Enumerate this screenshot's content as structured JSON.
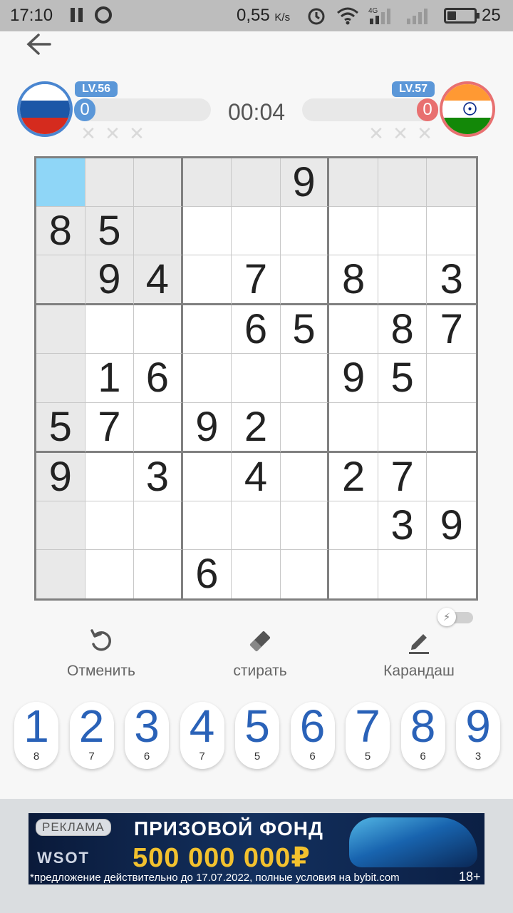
{
  "status_bar": {
    "time": "17:10",
    "speed_value": "0,55",
    "speed_unit": "K/s",
    "network": "4G",
    "battery": "25"
  },
  "players": {
    "left": {
      "country": "Russia",
      "level": "LV.56",
      "score": "0",
      "flag_colors": [
        "#ffffff",
        "#1c57a7",
        "#d52b1e"
      ],
      "mistakes": [
        "✕",
        "✕",
        "✕"
      ]
    },
    "right": {
      "country": "India",
      "level": "LV.57",
      "score": "0",
      "flag_colors": [
        "#ff9933",
        "#ffffff",
        "#138808"
      ],
      "mistakes": [
        "✕",
        "✕",
        "✕"
      ]
    }
  },
  "timer": "00:04",
  "board": {
    "selected_cell": [
      0,
      0
    ],
    "highlighted_cells": [
      [
        0,
        1
      ],
      [
        0,
        2
      ],
      [
        0,
        3
      ],
      [
        0,
        4
      ],
      [
        0,
        5
      ],
      [
        0,
        6
      ],
      [
        0,
        7
      ],
      [
        0,
        8
      ],
      [
        1,
        0
      ],
      [
        1,
        1
      ],
      [
        1,
        2
      ],
      [
        2,
        0
      ],
      [
        2,
        1
      ],
      [
        2,
        2
      ],
      [
        3,
        0
      ],
      [
        4,
        0
      ],
      [
        5,
        0
      ],
      [
        6,
        0
      ],
      [
        7,
        0
      ],
      [
        8,
        0
      ]
    ],
    "grid": [
      [
        "",
        "",
        "",
        "",
        "",
        "9",
        "",
        "",
        ""
      ],
      [
        "8",
        "5",
        "",
        "",
        "",
        "",
        "",
        "",
        ""
      ],
      [
        "",
        "9",
        "4",
        "",
        "7",
        "",
        "8",
        "",
        "3"
      ],
      [
        "",
        "",
        "",
        "",
        "6",
        "5",
        "",
        "8",
        "7"
      ],
      [
        "",
        "1",
        "6",
        "",
        "",
        "",
        "9",
        "5",
        ""
      ],
      [
        "5",
        "7",
        "",
        "9",
        "2",
        "",
        "",
        "",
        ""
      ],
      [
        "9",
        "",
        "3",
        "",
        "4",
        "",
        "2",
        "7",
        ""
      ],
      [
        "",
        "",
        "",
        "",
        "",
        "",
        "",
        "3",
        "9"
      ],
      [
        "",
        "",
        "",
        "6",
        "",
        "",
        "",
        "",
        ""
      ]
    ]
  },
  "auto_toggle": {
    "icon": "lightning-icon",
    "on": false
  },
  "tools": {
    "undo": {
      "label": "Отменить",
      "icon": "undo-icon"
    },
    "erase": {
      "label": "стирать",
      "icon": "eraser-icon"
    },
    "pencil": {
      "label": "Карандаш",
      "icon": "pencil-icon"
    }
  },
  "numpad": [
    {
      "value": "1",
      "remaining": "8"
    },
    {
      "value": "2",
      "remaining": "7"
    },
    {
      "value": "3",
      "remaining": "6"
    },
    {
      "value": "4",
      "remaining": "7"
    },
    {
      "value": "5",
      "remaining": "5"
    },
    {
      "value": "6",
      "remaining": "6"
    },
    {
      "value": "7",
      "remaining": "5"
    },
    {
      "value": "8",
      "remaining": "6"
    },
    {
      "value": "9",
      "remaining": "3"
    }
  ],
  "ad": {
    "label": "РЕКЛАМА",
    "brand": "WSOT",
    "headline": "ПРИЗОВОЙ ФОНД",
    "prize": "500 000 000₽",
    "disclaimer": "*предложение действительно до 17.07.2022, полные условия на bybit.com",
    "age_rating": "18+"
  },
  "colors": {
    "selected_cell": "#8fd6f7",
    "highlighted_cell": "#e9e9e9",
    "player_left": "#5b97d8",
    "player_right": "#e87070",
    "numpad_digit": "#2a62b8"
  }
}
